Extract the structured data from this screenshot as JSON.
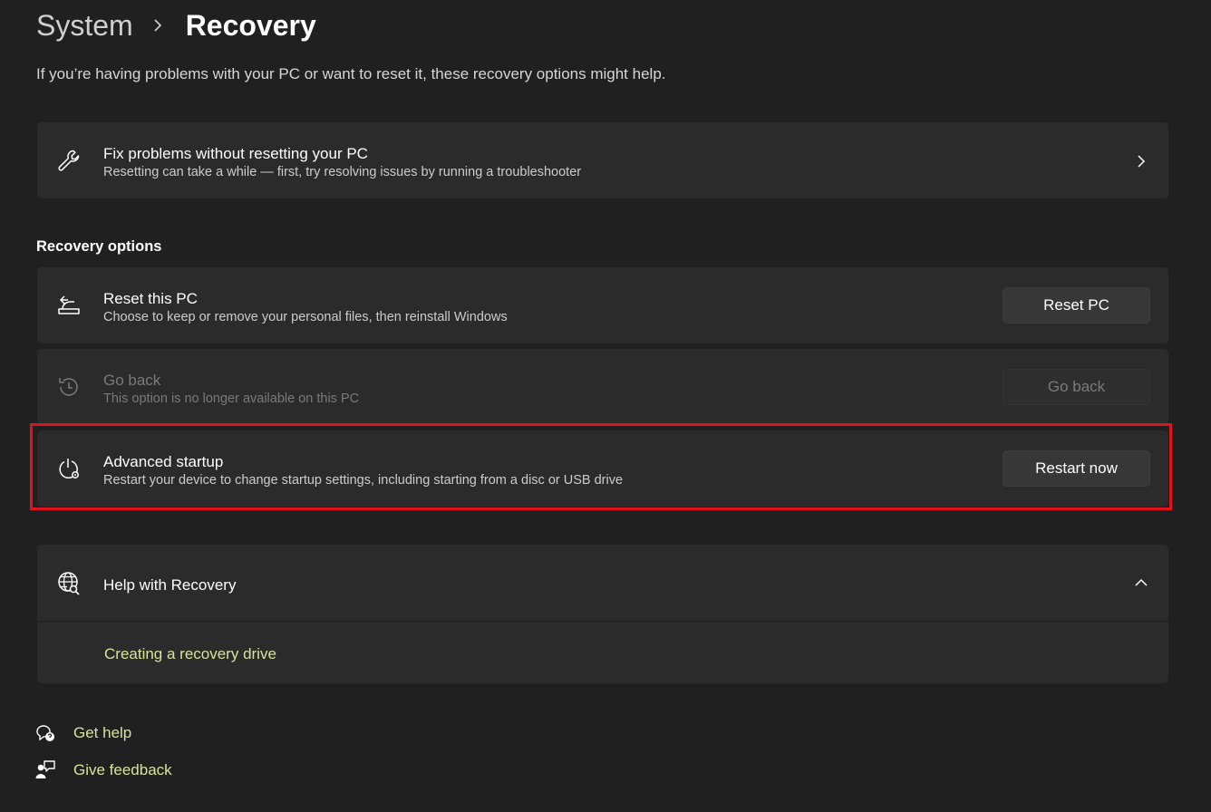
{
  "breadcrumb": {
    "parent": "System",
    "current": "Recovery"
  },
  "intro": "If you’re having problems with your PC or want to reset it, these recovery options might help.",
  "fix_card": {
    "title": "Fix problems without resetting your PC",
    "subtitle": "Resetting can take a while — first, try resolving issues by running a troubleshooter",
    "icon": "wrench-icon"
  },
  "section_title": "Recovery options",
  "options": [
    {
      "title": "Reset this PC",
      "subtitle": "Choose to keep or remove your personal files, then reinstall Windows",
      "button": "Reset PC",
      "icon": "reset-pc-icon",
      "enabled": true
    },
    {
      "title": "Go back",
      "subtitle": "This option is no longer available on this PC",
      "button": "Go back",
      "icon": "history-icon",
      "enabled": false
    },
    {
      "title": "Advanced startup",
      "subtitle": "Restart your device to change startup settings, including starting from a disc or USB drive",
      "button": "Restart now",
      "icon": "power-gear-icon",
      "enabled": true
    }
  ],
  "help": {
    "title": "Help with Recovery",
    "link": "Creating a recovery drive",
    "icon": "globe-search-icon",
    "expanded": true
  },
  "footer": {
    "get_help": "Get help",
    "give_feedback": "Give feedback"
  },
  "colors": {
    "background": "#202020",
    "card": "#2b2b2b",
    "link": "#d7e39a",
    "highlight": "#e0121b"
  }
}
